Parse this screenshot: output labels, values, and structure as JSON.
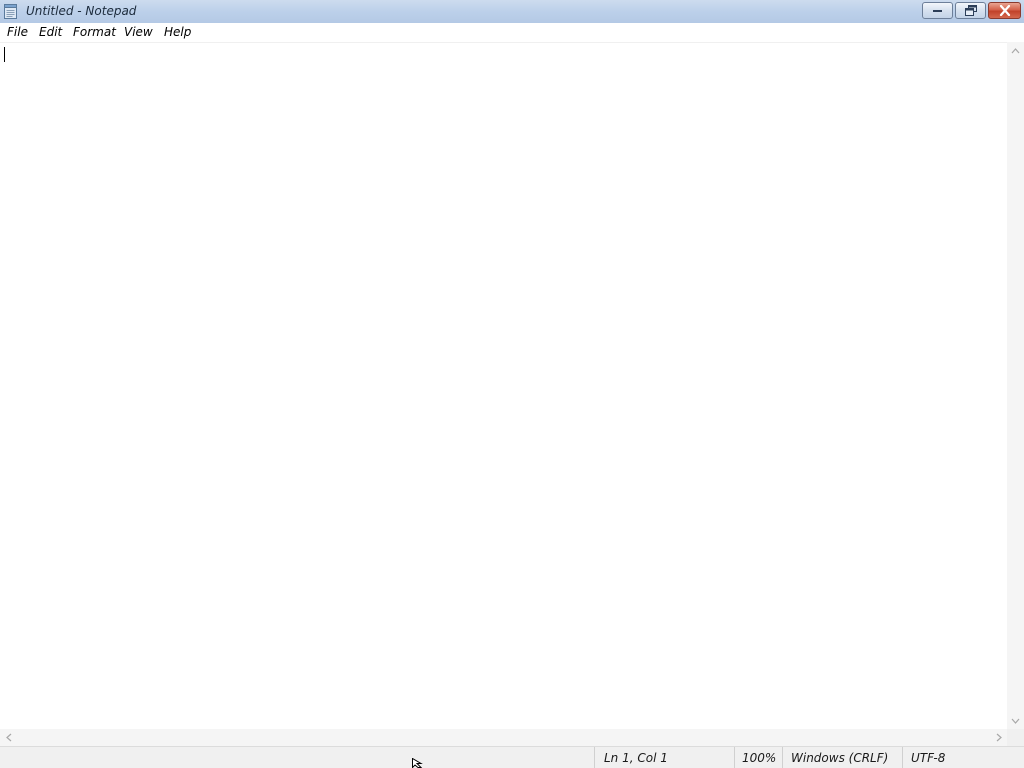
{
  "window": {
    "title": "Untitled - Notepad",
    "app_icon": "notepad-icon"
  },
  "caption_buttons": {
    "minimize_icon": "minimize-icon",
    "restore_icon": "restore-icon",
    "close_icon": "close-icon",
    "close_color": "#c8452c"
  },
  "menu": {
    "items": [
      {
        "label": "File"
      },
      {
        "label": "Edit"
      },
      {
        "label": "Format"
      },
      {
        "label": "View"
      },
      {
        "label": "Help"
      }
    ]
  },
  "editor": {
    "content": ""
  },
  "status_bar": {
    "position": "Ln 1, Col 1",
    "zoom": "100%",
    "line_ending": "Windows (CRLF)",
    "encoding": "UTF-8"
  }
}
